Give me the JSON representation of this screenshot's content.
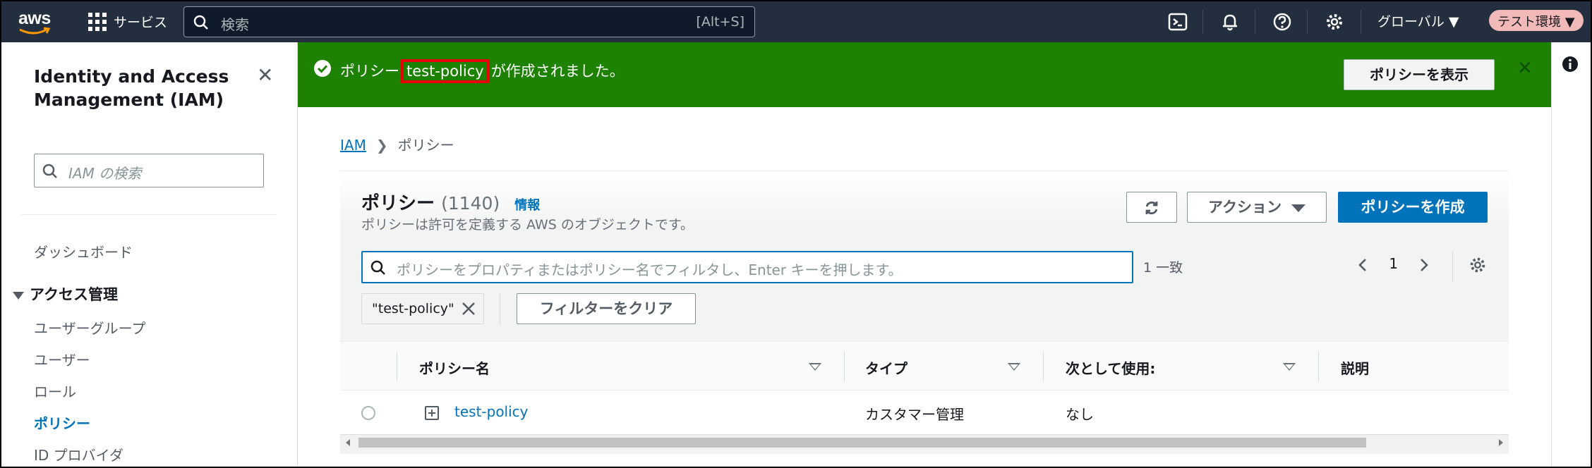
{
  "topnav": {
    "logo_text": "aws",
    "services_label": "サービス",
    "search_placeholder": "検索",
    "search_shortcut": "[Alt+S]",
    "region": "グローバル ▼",
    "account": "テスト環境 ▼"
  },
  "sidebar": {
    "title": "Identity and Access Management (IAM)",
    "search_placeholder": "IAM の検索",
    "dashboard": "ダッシュボード",
    "section": "アクセス管理",
    "items": [
      {
        "label": "ユーザーグループ",
        "active": false
      },
      {
        "label": "ユーザー",
        "active": false
      },
      {
        "label": "ロール",
        "active": false
      },
      {
        "label": "ポリシー",
        "active": true
      },
      {
        "label": "ID プロバイダ",
        "active": false
      }
    ]
  },
  "flash": {
    "prefix": "ポリシー",
    "policy_name": "test-policy",
    "suffix": "が作成されました。",
    "view_button": "ポリシーを表示"
  },
  "breadcrumb": {
    "root": "IAM",
    "current": "ポリシー"
  },
  "policies": {
    "title": "ポリシー",
    "count": "(1140)",
    "info": "情報",
    "description": "ポリシーは許可を定義する AWS のオブジェクトです。",
    "actions_label": "アクション",
    "create_label": "ポリシーを作成",
    "filter_placeholder": "ポリシーをプロパティまたはポリシー名でフィルタし、Enter キーを押します。",
    "match_count": "1 一致",
    "page": "1",
    "token": "\"test-policy\"",
    "clear_filters": "フィルターをクリア",
    "columns": [
      "ポリシー名",
      "タイプ",
      "次として使用:",
      "説明"
    ],
    "rows": [
      {
        "name": "test-policy",
        "type": "カスタマー管理",
        "used_as": "なし",
        "description": ""
      }
    ]
  },
  "colors": {
    "nav_bg": "#232f3e",
    "flash_success": "#1d8102",
    "highlight_box": "#e8000a",
    "link": "#0073bb",
    "primary": "#0073bb"
  }
}
